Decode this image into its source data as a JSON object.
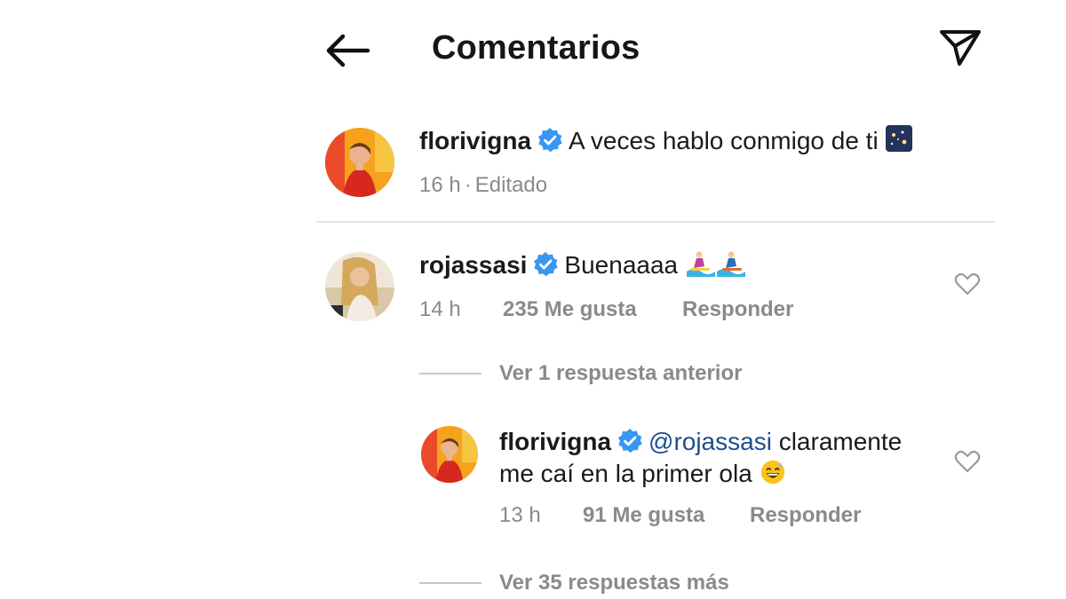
{
  "header": {
    "title": "Comentarios",
    "back_icon": "arrow-left-icon",
    "send_icon": "paper-plane-icon"
  },
  "caption": {
    "username": "florivigna",
    "text": "A veces hablo conmigo de ti",
    "emoji": "night-sky-emoji",
    "time": "16 h",
    "separator": "·",
    "edited": "Editado"
  },
  "comment": {
    "username": "rojassasi",
    "text": "Buenaaaa",
    "emoji": "surfer-emojis",
    "time": "14 h",
    "likes": "235 Me gusta",
    "reply": "Responder"
  },
  "previous_replies": {
    "label": "Ver 1 respuesta anterior"
  },
  "reply_comment": {
    "username": "florivigna",
    "mention": "@rojassasi",
    "text_line1": "claramente",
    "text_line2": "me caí en la primer ola",
    "emoji": "grinning-sweat-emoji",
    "time": "13 h",
    "likes": "91 Me gusta",
    "reply": "Responder"
  },
  "more_replies": {
    "label": "Ver 35 respuestas más"
  },
  "colors": {
    "verified": "#3897f0",
    "meta_text": "#8a8a8a",
    "mention": "#1d4e8f"
  }
}
